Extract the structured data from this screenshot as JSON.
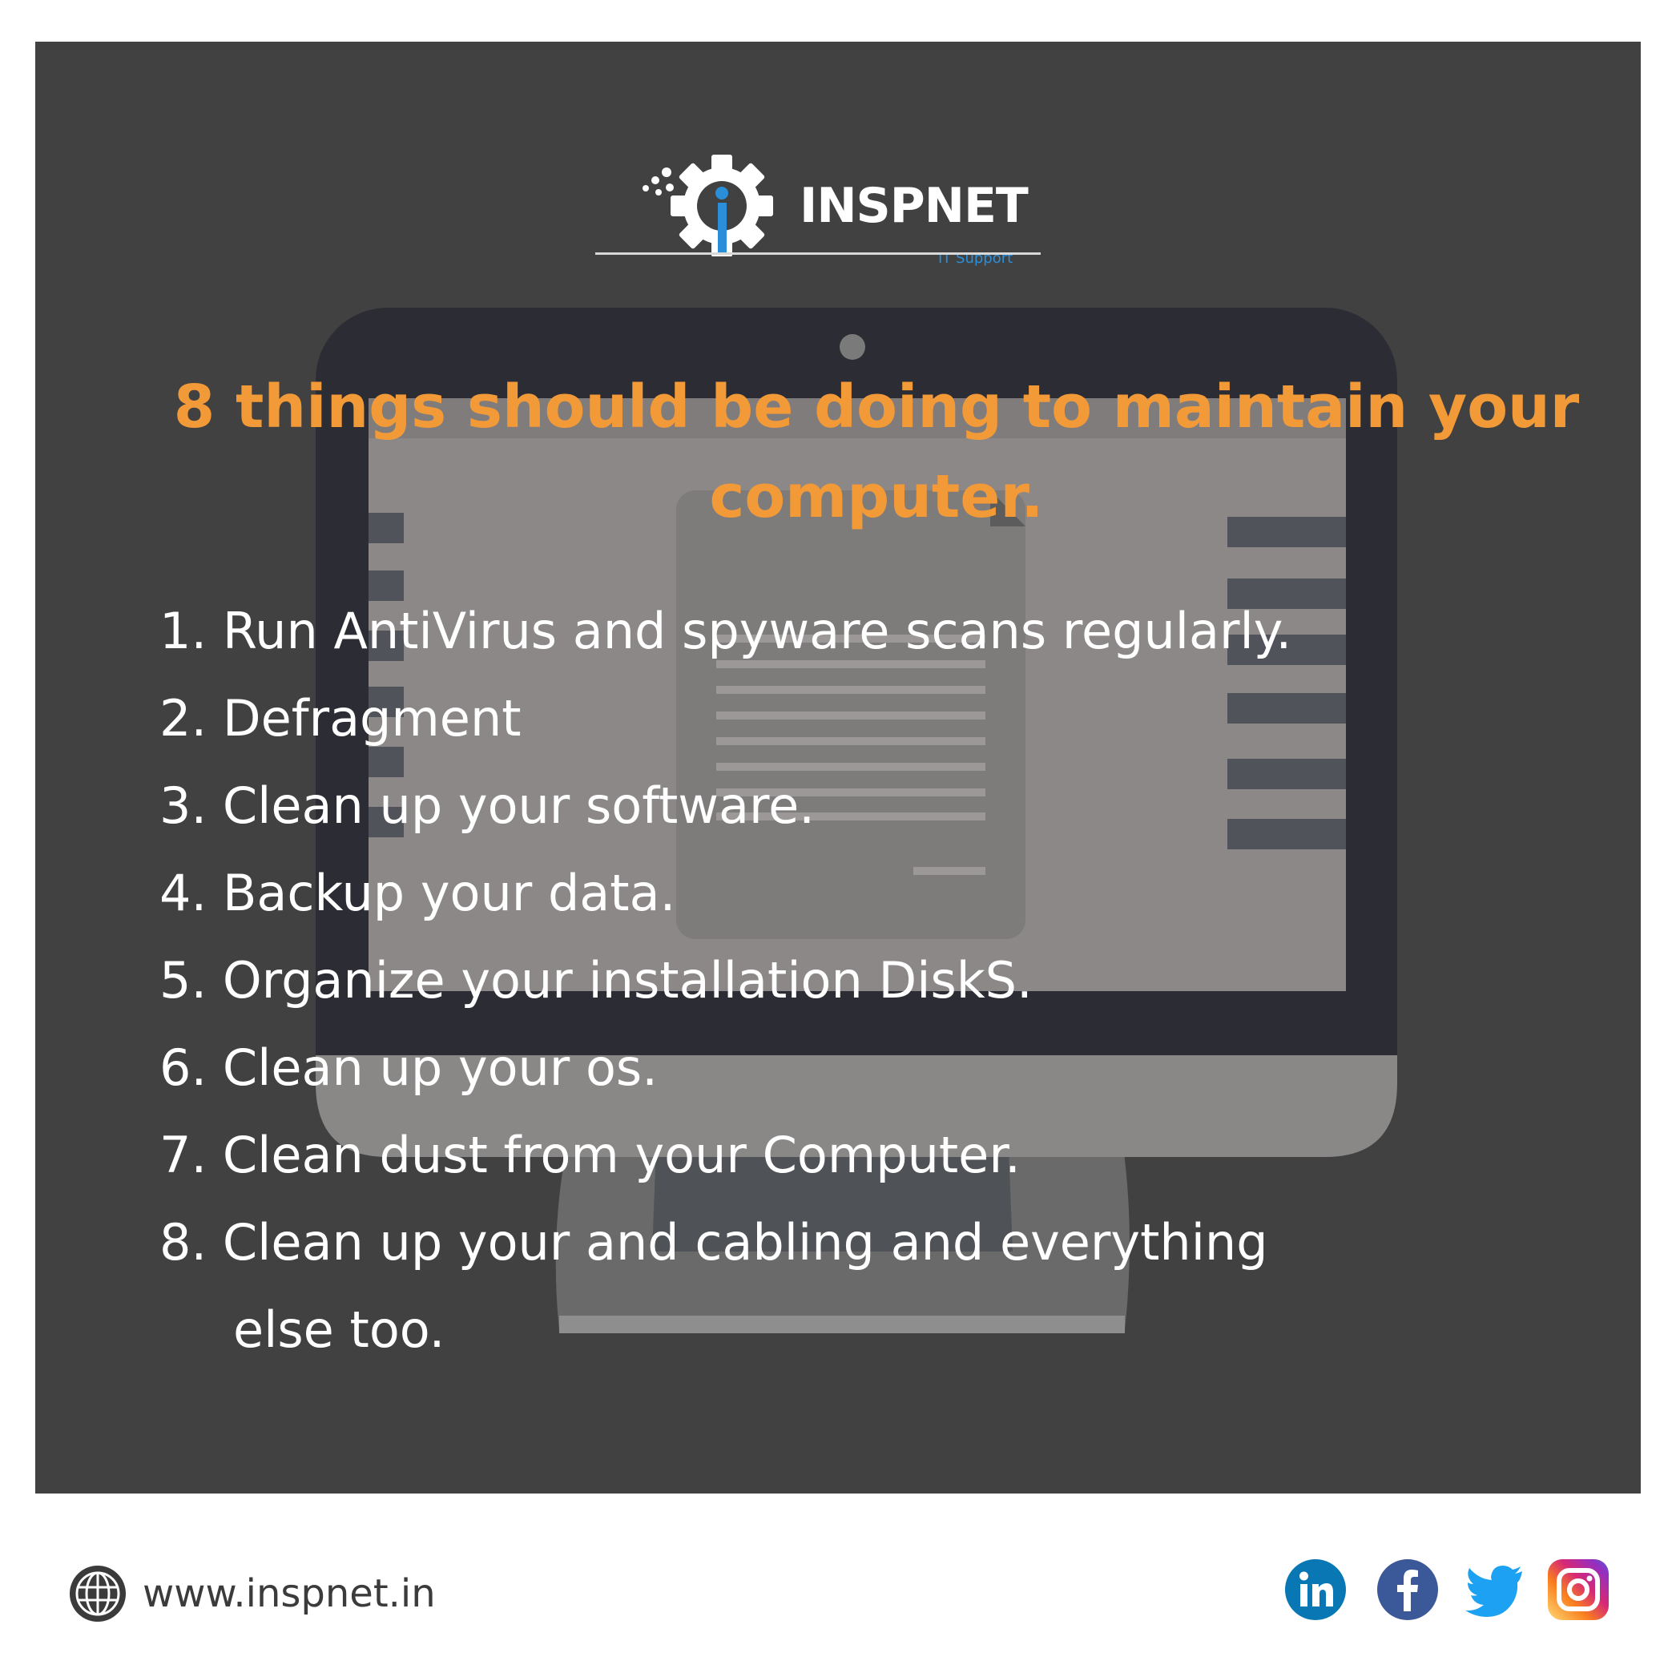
{
  "brand": {
    "name": "INSPNET",
    "tagline": "IT Support"
  },
  "title": "8 things should be doing to maintain your computer.",
  "items": [
    "1. Run AntiVirus and spyware scans regularly.",
    "2. Defragment",
    "3. Clean up your software.",
    "4. Backup your data.",
    "5. Organize your installation DiskS.",
    "6. Clean up your os.",
    "7. Clean dust from your Computer.",
    "8. Clean up your and cabling and everything",
    "else  too."
  ],
  "footer": {
    "website": "www.inspnet.in",
    "social_icons": [
      "linkedin-icon",
      "facebook-icon",
      "twitter-icon",
      "instagram-icon"
    ]
  },
  "colors": {
    "background": "#414141",
    "title": "#f39a38",
    "text": "#ffffff",
    "accent_blue": "#2a8fd8"
  }
}
